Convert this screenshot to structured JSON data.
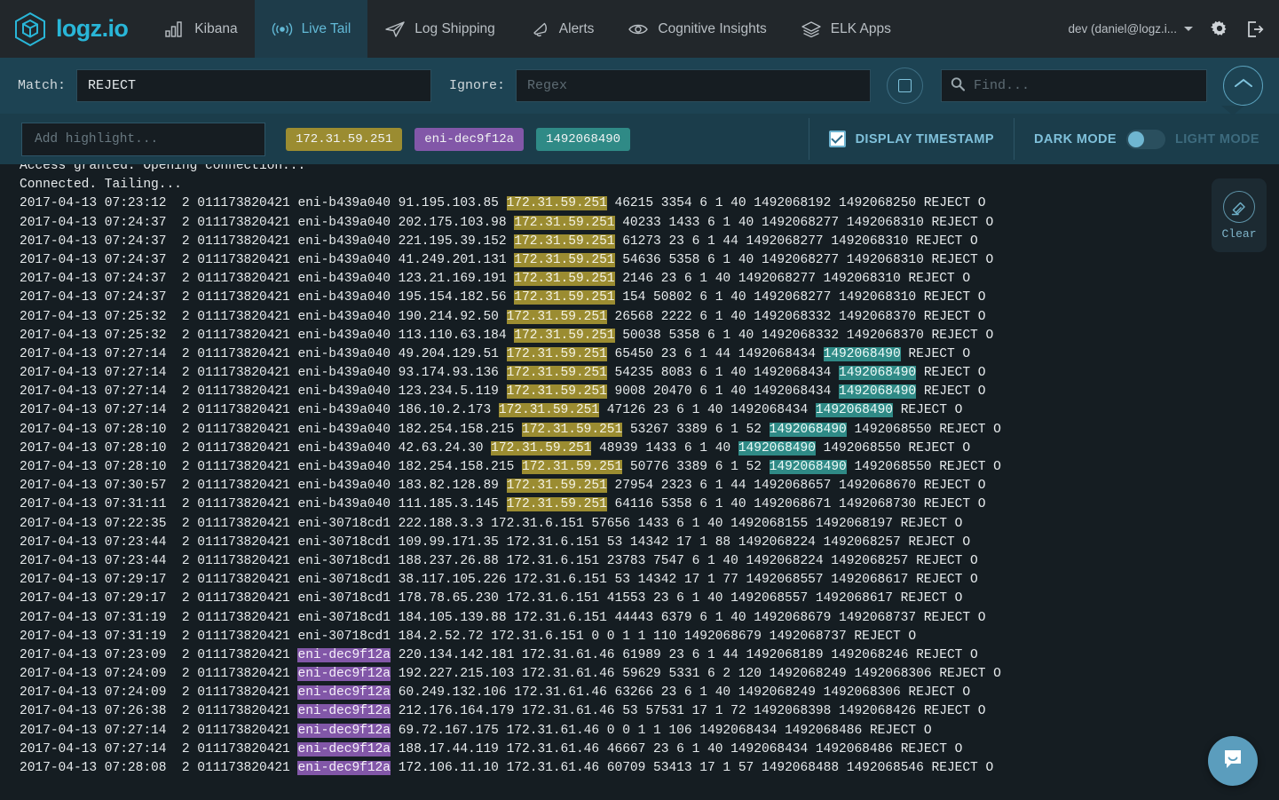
{
  "brand": {
    "name": "logz.io",
    "logo_icon": "logz-cube-icon",
    "accent": "#29b6d8"
  },
  "nav": {
    "items": [
      {
        "label": "Kibana",
        "icon": "bar-chart-icon",
        "active": false
      },
      {
        "label": "Live Tail",
        "icon": "broadcast-icon",
        "active": true
      },
      {
        "label": "Log Shipping",
        "icon": "paper-plane-icon",
        "active": false
      },
      {
        "label": "Alerts",
        "icon": "bell-icon",
        "active": false
      },
      {
        "label": "Cognitive Insights",
        "icon": "eye-icon",
        "active": false
      },
      {
        "label": "ELK Apps",
        "icon": "layers-icon",
        "active": false
      }
    ],
    "user_menu": "dev (daniel@logz.i...",
    "settings_icon": "gear-icon",
    "logout_icon": "logout-icon"
  },
  "search": {
    "match_label": "Match:",
    "match_value": "REJECT",
    "match_placeholder": "Regex",
    "ignore_label": "Ignore:",
    "ignore_value": "",
    "ignore_placeholder": "Regex",
    "stop_icon": "stop-square-icon",
    "find_value": "",
    "find_placeholder": "Find...",
    "find_icon": "search-icon",
    "collapse_icon": "chevron-up-icon"
  },
  "highlights": {
    "input_value": "",
    "input_placeholder": "Add highlight...",
    "chips": [
      {
        "text": "172.31.59.251",
        "color": "#9b8c31"
      },
      {
        "text": "eni-dec9f12a",
        "color": "#8257a8"
      },
      {
        "text": "1492068490",
        "color": "#2f8a86"
      }
    ]
  },
  "options": {
    "display_timestamp_label": "DISPLAY TIMESTAMP",
    "display_timestamp_checked": true,
    "dark_mode_label": "DARK MODE",
    "light_mode_label": "LIGHT MODE",
    "mode": "dark"
  },
  "clear": {
    "label": "Clear",
    "icon": "eraser-icon"
  },
  "chat": {
    "icon": "chat-bubble-icon",
    "color": "#5b9dbd"
  },
  "log": {
    "lines": [
      [
        {
          "t": "Access granted. Opening connection..."
        }
      ],
      [
        {
          "t": "Connected. Tailing..."
        }
      ],
      [
        {
          "t": "2017-04-13 07:23:12  2 011173820421 eni-b439a040 91.195.103.85 "
        },
        {
          "t": "172.31.59.251",
          "h": "gold"
        },
        {
          "t": " 46215 3354 6 1 40 1492068192 1492068250 REJECT O"
        }
      ],
      [
        {
          "t": "2017-04-13 07:24:37  2 011173820421 eni-b439a040 202.175.103.98 "
        },
        {
          "t": "172.31.59.251",
          "h": "gold"
        },
        {
          "t": " 40233 1433 6 1 40 1492068277 1492068310 REJECT O"
        }
      ],
      [
        {
          "t": "2017-04-13 07:24:37  2 011173820421 eni-b439a040 221.195.39.152 "
        },
        {
          "t": "172.31.59.251",
          "h": "gold"
        },
        {
          "t": " 61273 23 6 1 44 1492068277 1492068310 REJECT O"
        }
      ],
      [
        {
          "t": "2017-04-13 07:24:37  2 011173820421 eni-b439a040 41.249.201.131 "
        },
        {
          "t": "172.31.59.251",
          "h": "gold"
        },
        {
          "t": " 54636 5358 6 1 40 1492068277 1492068310 REJECT O"
        }
      ],
      [
        {
          "t": "2017-04-13 07:24:37  2 011173820421 eni-b439a040 123.21.169.191 "
        },
        {
          "t": "172.31.59.251",
          "h": "gold"
        },
        {
          "t": " 2146 23 6 1 40 1492068277 1492068310 REJECT O"
        }
      ],
      [
        {
          "t": "2017-04-13 07:24:37  2 011173820421 eni-b439a040 195.154.182.56 "
        },
        {
          "t": "172.31.59.251",
          "h": "gold"
        },
        {
          "t": " 154 50802 6 1 40 1492068277 1492068310 REJECT O"
        }
      ],
      [
        {
          "t": "2017-04-13 07:25:32  2 011173820421 eni-b439a040 190.214.92.50 "
        },
        {
          "t": "172.31.59.251",
          "h": "gold"
        },
        {
          "t": " 26568 2222 6 1 40 1492068332 1492068370 REJECT O"
        }
      ],
      [
        {
          "t": "2017-04-13 07:25:32  2 011173820421 eni-b439a040 113.110.63.184 "
        },
        {
          "t": "172.31.59.251",
          "h": "gold"
        },
        {
          "t": " 50038 5358 6 1 40 1492068332 1492068370 REJECT O"
        }
      ],
      [
        {
          "t": "2017-04-13 07:27:14  2 011173820421 eni-b439a040 49.204.129.51 "
        },
        {
          "t": "172.31.59.251",
          "h": "gold"
        },
        {
          "t": " 65450 23 6 1 44 1492068434 "
        },
        {
          "t": "1492068490",
          "h": "teal"
        },
        {
          "t": " REJECT O"
        }
      ],
      [
        {
          "t": "2017-04-13 07:27:14  2 011173820421 eni-b439a040 93.174.93.136 "
        },
        {
          "t": "172.31.59.251",
          "h": "gold"
        },
        {
          "t": " 54235 8083 6 1 40 1492068434 "
        },
        {
          "t": "1492068490",
          "h": "teal"
        },
        {
          "t": " REJECT O"
        }
      ],
      [
        {
          "t": "2017-04-13 07:27:14  2 011173820421 eni-b439a040 123.234.5.119 "
        },
        {
          "t": "172.31.59.251",
          "h": "gold"
        },
        {
          "t": " 9008 20470 6 1 40 1492068434 "
        },
        {
          "t": "1492068490",
          "h": "teal"
        },
        {
          "t": " REJECT O"
        }
      ],
      [
        {
          "t": "2017-04-13 07:27:14  2 011173820421 eni-b439a040 186.10.2.173 "
        },
        {
          "t": "172.31.59.251",
          "h": "gold"
        },
        {
          "t": " 47126 23 6 1 40 1492068434 "
        },
        {
          "t": "1492068490",
          "h": "teal"
        },
        {
          "t": " REJECT O"
        }
      ],
      [
        {
          "t": "2017-04-13 07:28:10  2 011173820421 eni-b439a040 182.254.158.215 "
        },
        {
          "t": "172.31.59.251",
          "h": "gold"
        },
        {
          "t": " 53267 3389 6 1 52 "
        },
        {
          "t": "1492068490",
          "h": "teal"
        },
        {
          "t": " 1492068550 REJECT O"
        }
      ],
      [
        {
          "t": "2017-04-13 07:28:10  2 011173820421 eni-b439a040 42.63.24.30 "
        },
        {
          "t": "172.31.59.251",
          "h": "gold"
        },
        {
          "t": " 48939 1433 6 1 40 "
        },
        {
          "t": "1492068490",
          "h": "teal"
        },
        {
          "t": " 1492068550 REJECT O"
        }
      ],
      [
        {
          "t": "2017-04-13 07:28:10  2 011173820421 eni-b439a040 182.254.158.215 "
        },
        {
          "t": "172.31.59.251",
          "h": "gold"
        },
        {
          "t": " 50776 3389 6 1 52 "
        },
        {
          "t": "1492068490",
          "h": "teal"
        },
        {
          "t": " 1492068550 REJECT O"
        }
      ],
      [
        {
          "t": "2017-04-13 07:30:57  2 011173820421 eni-b439a040 183.82.128.89 "
        },
        {
          "t": "172.31.59.251",
          "h": "gold"
        },
        {
          "t": " 27954 2323 6 1 44 1492068657 1492068670 REJECT O"
        }
      ],
      [
        {
          "t": "2017-04-13 07:31:11  2 011173820421 eni-b439a040 111.185.3.145 "
        },
        {
          "t": "172.31.59.251",
          "h": "gold"
        },
        {
          "t": " 64116 5358 6 1 40 1492068671 1492068730 REJECT O"
        }
      ],
      [
        {
          "t": "2017-04-13 07:22:35  2 011173820421 eni-30718cd1 222.188.3.3 172.31.6.151 57656 1433 6 1 40 1492068155 1492068197 REJECT O"
        }
      ],
      [
        {
          "t": "2017-04-13 07:23:44  2 011173820421 eni-30718cd1 109.99.171.35 172.31.6.151 53 14342 17 1 88 1492068224 1492068257 REJECT O"
        }
      ],
      [
        {
          "t": "2017-04-13 07:23:44  2 011173820421 eni-30718cd1 188.237.26.88 172.31.6.151 23783 7547 6 1 40 1492068224 1492068257 REJECT O"
        }
      ],
      [
        {
          "t": "2017-04-13 07:29:17  2 011173820421 eni-30718cd1 38.117.105.226 172.31.6.151 53 14342 17 1 77 1492068557 1492068617 REJECT O"
        }
      ],
      [
        {
          "t": "2017-04-13 07:29:17  2 011173820421 eni-30718cd1 178.78.65.230 172.31.6.151 41553 23 6 1 40 1492068557 1492068617 REJECT O"
        }
      ],
      [
        {
          "t": "2017-04-13 07:31:19  2 011173820421 eni-30718cd1 184.105.139.88 172.31.6.151 44443 6379 6 1 40 1492068679 1492068737 REJECT O"
        }
      ],
      [
        {
          "t": "2017-04-13 07:31:19  2 011173820421 eni-30718cd1 184.2.52.72 172.31.6.151 0 0 1 1 110 1492068679 1492068737 REJECT O"
        }
      ],
      [
        {
          "t": "2017-04-13 07:23:09  2 011173820421 "
        },
        {
          "t": "eni-dec9f12a",
          "h": "purple"
        },
        {
          "t": " 220.134.142.181 172.31.61.46 61989 23 6 1 44 1492068189 1492068246 REJECT O"
        }
      ],
      [
        {
          "t": "2017-04-13 07:24:09  2 011173820421 "
        },
        {
          "t": "eni-dec9f12a",
          "h": "purple"
        },
        {
          "t": " 192.227.215.103 172.31.61.46 59629 5331 6 2 120 1492068249 1492068306 REJECT O"
        }
      ],
      [
        {
          "t": "2017-04-13 07:24:09  2 011173820421 "
        },
        {
          "t": "eni-dec9f12a",
          "h": "purple"
        },
        {
          "t": " 60.249.132.106 172.31.61.46 63266 23 6 1 40 1492068249 1492068306 REJECT O"
        }
      ],
      [
        {
          "t": "2017-04-13 07:26:38  2 011173820421 "
        },
        {
          "t": "eni-dec9f12a",
          "h": "purple"
        },
        {
          "t": " 212.176.164.179 172.31.61.46 53 57531 17 1 72 1492068398 1492068426 REJECT O"
        }
      ],
      [
        {
          "t": "2017-04-13 07:27:14  2 011173820421 "
        },
        {
          "t": "eni-dec9f12a",
          "h": "purple"
        },
        {
          "t": " 69.72.167.175 172.31.61.46 0 0 1 1 106 1492068434 1492068486 REJECT O"
        }
      ],
      [
        {
          "t": "2017-04-13 07:27:14  2 011173820421 "
        },
        {
          "t": "eni-dec9f12a",
          "h": "purple"
        },
        {
          "t": " 188.17.44.119 172.31.61.46 46667 23 6 1 40 1492068434 1492068486 REJECT O"
        }
      ],
      [
        {
          "t": "2017-04-13 07:28:08  2 011173820421 "
        },
        {
          "t": "eni-dec9f12a",
          "h": "purple"
        },
        {
          "t": " 172.106.11.10 172.31.61.46 60709 53413 17 1 57 1492068488 1492068546 REJECT O"
        }
      ]
    ]
  }
}
